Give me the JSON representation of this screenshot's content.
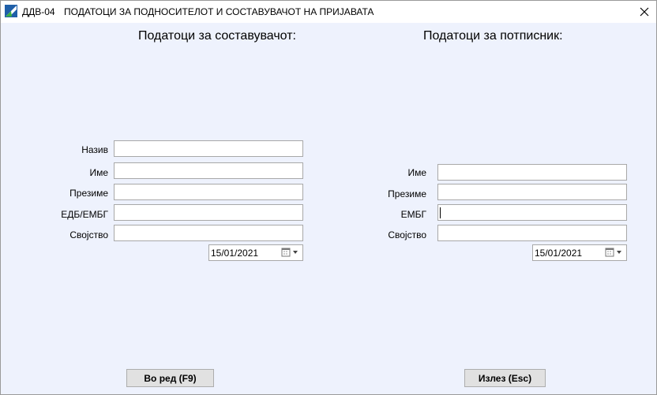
{
  "window": {
    "code": "ДДВ-04",
    "title": "ПОДАТОЦИ ЗА ПОДНОСИТЕЛОТ И СОСТАВУВАЧОТ НА ПРИЈАВАТА",
    "close_icon": "close-icon"
  },
  "composer": {
    "heading": "Податоци за составувачот:",
    "fields": [
      {
        "label": "Назив",
        "value": ""
      },
      {
        "label": "Име",
        "value": ""
      },
      {
        "label": "Презиме",
        "value": ""
      },
      {
        "label": "ЕДБ/ЕМБГ",
        "value": ""
      },
      {
        "label": "Својство",
        "value": ""
      }
    ],
    "date": "15/01/2021"
  },
  "signer": {
    "heading": "Податоци за потписник:",
    "fields": [
      {
        "label": "Име",
        "value": ""
      },
      {
        "label": "Презиме",
        "value": ""
      },
      {
        "label": "ЕМБГ",
        "value": ""
      },
      {
        "label": "Својство",
        "value": ""
      }
    ],
    "date": "15/01/2021"
  },
  "buttons": {
    "ok": "Во ред (F9)",
    "exit": "Излез (Esc)"
  },
  "colors": {
    "background": "#eef2fd",
    "button": "#e1e1e1"
  }
}
